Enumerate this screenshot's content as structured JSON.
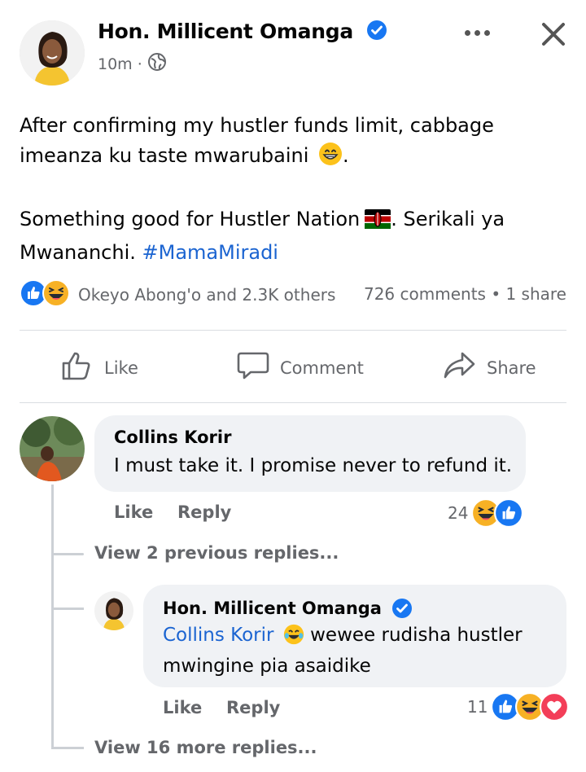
{
  "post": {
    "author": "Hon. Millicent Omanga",
    "time": "10m",
    "privacy_icon": "globe-icon",
    "paragraph1": "After confirming my hustler funds limit, cabbage imeanza ku taste mwarubaini",
    "paragraph2_text": "Something good for Hustler Nation",
    "paragraph2_after_flag": ". Serikali ya Mwananchi.",
    "hashtag": "#MamaMiradi",
    "reactions_text": "Okeyo Abong'o and 2.3K others",
    "counts_text": "726 comments • 1 share"
  },
  "actions": {
    "like": "Like",
    "comment": "Comment",
    "share": "Share"
  },
  "comments": [
    {
      "name": "Collins Korir",
      "text": "I must take it. I promise never to refund it.",
      "like_label": "Like",
      "reply_label": "Reply",
      "reaction_count": "24"
    }
  ],
  "view_previous": "View 2 previous replies...",
  "reply": {
    "name": "Hon. Millicent Omanga",
    "mention": "Collins Korir",
    "text": " wewee rudisha hustler mwingine pia asaidike",
    "like_label": "Like",
    "reply_label": "Reply",
    "reaction_count": "11"
  },
  "view_more": "View 16 more replies...",
  "colors": {
    "accent": "#1b64d1",
    "like_blue": "#1877f2",
    "haha_yellow": "#f7b125",
    "love_red": "#f33e58",
    "muted": "#65676b"
  }
}
